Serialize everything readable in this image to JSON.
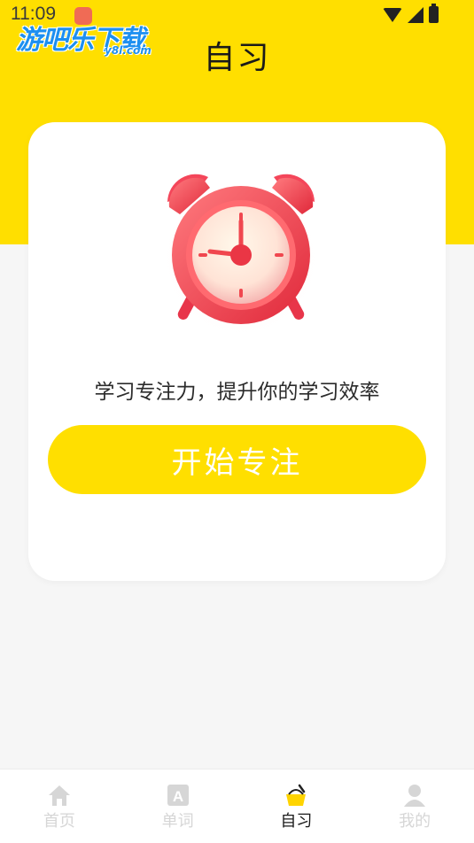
{
  "status_bar": {
    "time": "11:09"
  },
  "watermark": {
    "text": "游吧乐下载",
    "sub": "y8l.com"
  },
  "header": {
    "title": "自习"
  },
  "card": {
    "tagline": "学习专注力，提升你的学习效率",
    "start_button_label": "开始专注",
    "illustration": "alarm-clock-icon"
  },
  "tabs": [
    {
      "label": "首页",
      "icon": "home-icon",
      "active": false
    },
    {
      "label": "单词",
      "icon": "word-card-icon",
      "active": false
    },
    {
      "label": "自习",
      "icon": "study-basket-icon",
      "active": true
    },
    {
      "label": "我的",
      "icon": "user-icon",
      "active": false
    }
  ],
  "colors": {
    "brand_yellow": "#ffdf00",
    "background": "#f6f6f6",
    "clock_red": "#f0474f",
    "inactive_tab": "#d6d6d6"
  }
}
